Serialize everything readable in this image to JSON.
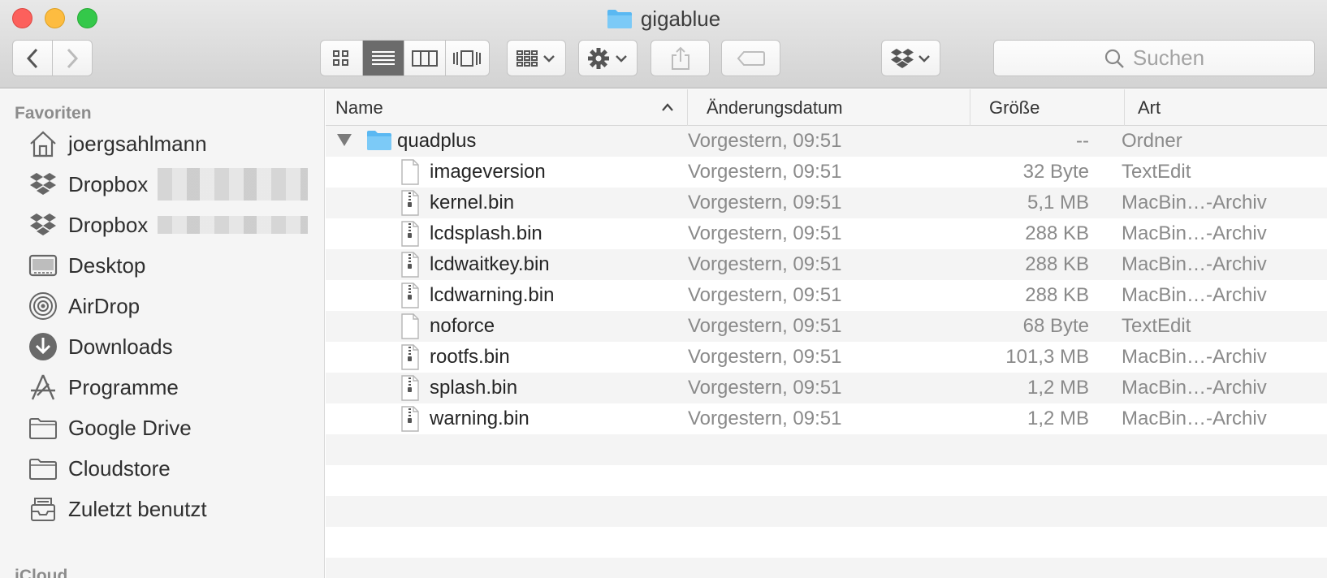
{
  "window": {
    "title": "gigablue"
  },
  "toolbar": {
    "back": "back",
    "forward": "forward",
    "views": [
      "icon-view",
      "list-view",
      "column-view",
      "cover-flow-view"
    ],
    "active_view": "list-view",
    "search_placeholder": "Suchen"
  },
  "sidebar": {
    "heading": "Favoriten",
    "items": [
      {
        "label": "joergsahlmann",
        "icon": "home-icon"
      },
      {
        "label": "Dropbox",
        "icon": "dropbox-icon",
        "redacted": true
      },
      {
        "label": "Dropbox",
        "icon": "dropbox-icon",
        "redacted": true
      },
      {
        "label": "Desktop",
        "icon": "desktop-icon"
      },
      {
        "label": "AirDrop",
        "icon": "airdrop-icon"
      },
      {
        "label": "Downloads",
        "icon": "downloads-icon"
      },
      {
        "label": "Programme",
        "icon": "applications-icon"
      },
      {
        "label": "Google Drive",
        "icon": "folder-icon"
      },
      {
        "label": "Cloudstore",
        "icon": "folder-icon"
      },
      {
        "label": "Zuletzt benutzt",
        "icon": "recents-icon"
      }
    ],
    "next_heading": "iCloud"
  },
  "columns": {
    "name": "Name",
    "date": "Änderungsdatum",
    "size": "Größe",
    "kind": "Art"
  },
  "files": [
    {
      "name": "quadplus",
      "date": "Vorgestern, 09:51",
      "size": "--",
      "kind": "Ordner",
      "type": "folder"
    },
    {
      "name": "imageversion",
      "date": "Vorgestern, 09:51",
      "size": "32 Byte",
      "kind": "TextEdit",
      "type": "text"
    },
    {
      "name": "kernel.bin",
      "date": "Vorgestern, 09:51",
      "size": "5,1 MB",
      "kind": "MacBin…-Archiv",
      "type": "archive"
    },
    {
      "name": "lcdsplash.bin",
      "date": "Vorgestern, 09:51",
      "size": "288 KB",
      "kind": "MacBin…-Archiv",
      "type": "archive"
    },
    {
      "name": "lcdwaitkey.bin",
      "date": "Vorgestern, 09:51",
      "size": "288 KB",
      "kind": "MacBin…-Archiv",
      "type": "archive"
    },
    {
      "name": "lcdwarning.bin",
      "date": "Vorgestern, 09:51",
      "size": "288 KB",
      "kind": "MacBin…-Archiv",
      "type": "archive"
    },
    {
      "name": "noforce",
      "date": "Vorgestern, 09:51",
      "size": "68 Byte",
      "kind": "TextEdit",
      "type": "text"
    },
    {
      "name": "rootfs.bin",
      "date": "Vorgestern, 09:51",
      "size": "101,3 MB",
      "kind": "MacBin…-Archiv",
      "type": "archive"
    },
    {
      "name": "splash.bin",
      "date": "Vorgestern, 09:51",
      "size": "1,2 MB",
      "kind": "MacBin…-Archiv",
      "type": "archive"
    },
    {
      "name": "warning.bin",
      "date": "Vorgestern, 09:51",
      "size": "1,2 MB",
      "kind": "MacBin…-Archiv",
      "type": "archive"
    }
  ],
  "colors": {
    "folder_blue": "#5ab8f2",
    "active_segment": "#6b6b6b"
  }
}
